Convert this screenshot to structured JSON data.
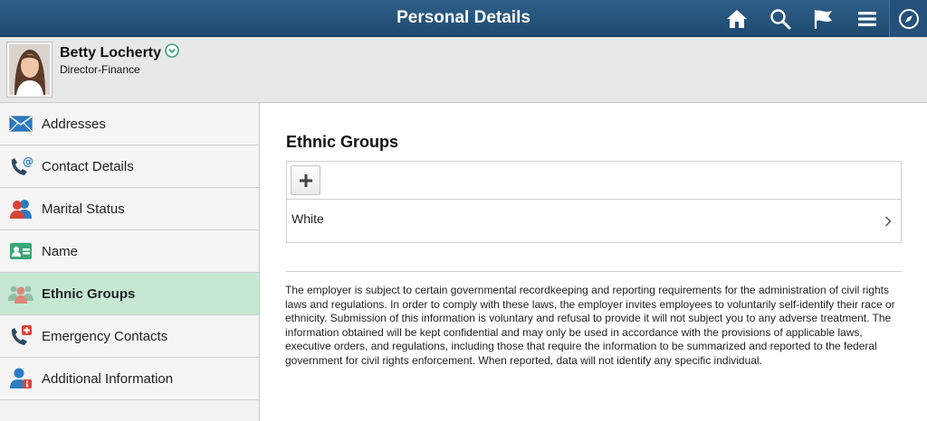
{
  "header": {
    "title": "Personal Details",
    "icons": [
      "home-icon",
      "search-icon",
      "flag-icon",
      "menu-icon",
      "navbar-compass-icon"
    ]
  },
  "profile": {
    "name": "Betty Locherty",
    "job_title": "Director-Finance"
  },
  "sidebar": {
    "items": [
      {
        "label": "Addresses",
        "icon": "envelope-icon"
      },
      {
        "label": "Contact Details",
        "icon": "phone-at-icon"
      },
      {
        "label": "Marital Status",
        "icon": "couple-icon"
      },
      {
        "label": "Name",
        "icon": "id-card-icon"
      },
      {
        "label": "Ethnic Groups",
        "icon": "group-icon",
        "active": true
      },
      {
        "label": "Emergency Contacts",
        "icon": "phone-cross-icon"
      },
      {
        "label": "Additional Information",
        "icon": "person-info-icon"
      }
    ]
  },
  "main": {
    "title": "Ethnic Groups",
    "rows": [
      {
        "label": "White"
      }
    ],
    "disclaimer": "The employer is subject to certain governmental recordkeeping and reporting requirements for the administration of civil rights laws and regulations. In order to comply with these laws, the employer invites employees to voluntarily self-identify their race or ethnicity. Submission of this information is voluntary and refusal to provide it will not subject you to any adverse treatment. The information obtained will be kept confidential and may only be used in accordance with the provisions of applicable laws, executive orders, and regulations, including those that require the information to be summarized and reported to the federal government for civil rights enforcement. When reported, data will not identify any specific individual."
  },
  "colors": {
    "header_bg": "#2a5a82",
    "active_item_bg": "#c6e8d3",
    "accent_green": "#3aa676"
  }
}
